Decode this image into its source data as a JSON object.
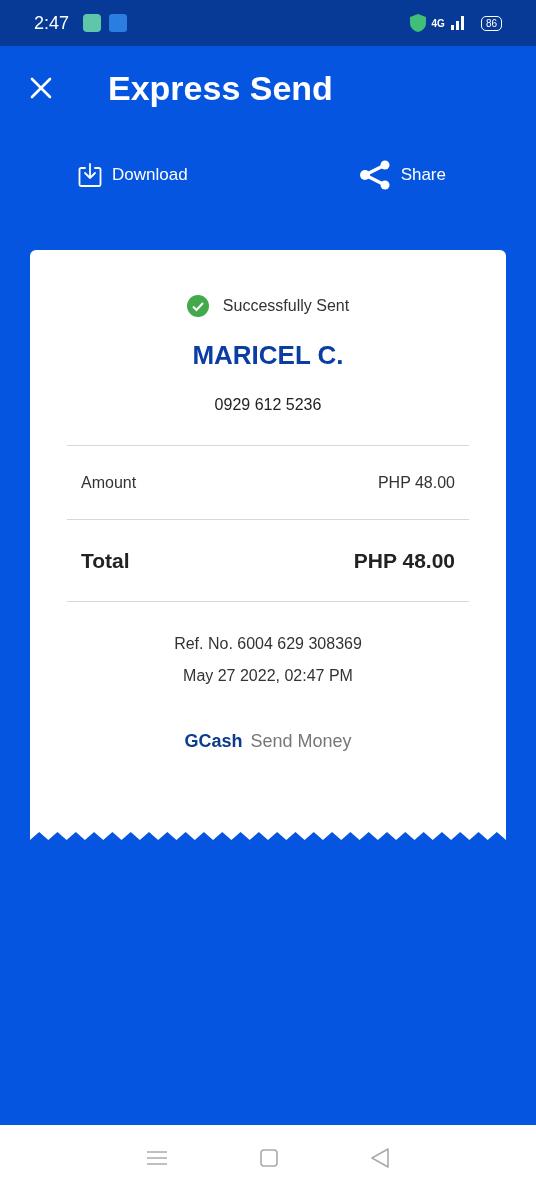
{
  "status_bar": {
    "time": "2:47",
    "network": "4G",
    "battery": "86"
  },
  "header": {
    "title": "Express Send"
  },
  "actions": [
    {
      "kind": "download",
      "label": "Download"
    },
    {
      "kind": "share",
      "label": "Share"
    }
  ],
  "receipt": {
    "status": "Successfully Sent",
    "recipient": "MARICEL C.",
    "phone": "0929 612 5236",
    "lines": [
      {
        "kind": "item",
        "label": "Amount",
        "value": "PHP 48.00"
      },
      {
        "kind": "total",
        "label": "Total",
        "value": "PHP 48.00"
      }
    ],
    "reference": "Ref. No. 6004 629 308369",
    "datetime": "May 27 2022, 02:47 PM",
    "brand": "GCash",
    "service": "Send Money"
  }
}
